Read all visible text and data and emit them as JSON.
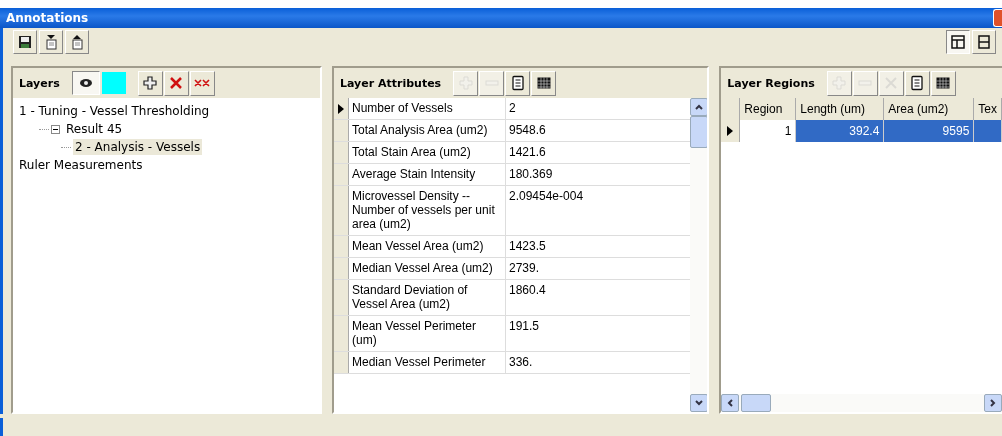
{
  "window": {
    "title": "Annotations"
  },
  "toolbar": {
    "buttons": [
      {
        "kind": "save"
      },
      {
        "kind": "import"
      },
      {
        "kind": "export"
      }
    ],
    "view_buttons": [
      {
        "kind": "split-horizontal",
        "selected": true
      },
      {
        "kind": "split-vertical",
        "selected": false
      }
    ]
  },
  "layers": {
    "title": "Layers",
    "visible": true,
    "color": "#00ffff",
    "buttons": [
      {
        "kind": "add",
        "disabled": false
      },
      {
        "kind": "delete",
        "disabled": false
      },
      {
        "kind": "delete-all",
        "disabled": false
      }
    ],
    "tree": [
      {
        "label": "1 - Tuning - Vessel Thresholding",
        "selected": false,
        "children": [
          {
            "label": "Result 45",
            "selected": false,
            "expanded": true,
            "children": [
              {
                "label": "2 - Analysis - Vessels",
                "selected": true
              }
            ]
          }
        ]
      },
      {
        "label": "Ruler Measurements",
        "selected": false
      }
    ]
  },
  "attributes": {
    "title": "Layer Attributes",
    "buttons": [
      {
        "kind": "add",
        "disabled": true
      },
      {
        "kind": "remove",
        "disabled": true
      },
      {
        "kind": "notes",
        "disabled": false
      },
      {
        "kind": "grid",
        "disabled": false
      }
    ],
    "rows": [
      {
        "name": "Number of Vessels",
        "value": "2",
        "current": true
      },
      {
        "name": "Total Analysis Area (um2)",
        "value": "9548.6",
        "current": false
      },
      {
        "name": "Total Stain Area (um2)",
        "value": "1421.6",
        "current": false
      },
      {
        "name": "Average Stain Intensity",
        "value": "180.369",
        "current": false
      },
      {
        "name": "Microvessel Density -- Number of vessels per unit area (um2)",
        "value": "2.09454e-004",
        "current": false
      },
      {
        "name": "Mean Vessel Area (um2)",
        "value": "1423.5",
        "current": false
      },
      {
        "name": "Median Vessel Area (um2)",
        "value": "2739.",
        "current": false
      },
      {
        "name": "Standard Deviation of Vessel Area (um2)",
        "value": "1860.4",
        "current": false
      },
      {
        "name": "Mean Vessel Perimeter (um)",
        "value": "191.5",
        "current": false
      },
      {
        "name": "Median Vessel Perimeter",
        "value": "336.",
        "current": false
      }
    ]
  },
  "regions": {
    "title": "Layer Regions",
    "buttons": [
      {
        "kind": "add",
        "disabled": true
      },
      {
        "kind": "remove",
        "disabled": true
      },
      {
        "kind": "delete",
        "disabled": true
      },
      {
        "kind": "notes",
        "disabled": false
      },
      {
        "kind": "grid",
        "disabled": false
      }
    ],
    "columns": [
      "Region",
      "Length (um)",
      "Area (um2)",
      "Tex"
    ],
    "rows": [
      {
        "cells": [
          "1",
          "392.4",
          "9595"
        ],
        "selected": true
      }
    ]
  }
}
